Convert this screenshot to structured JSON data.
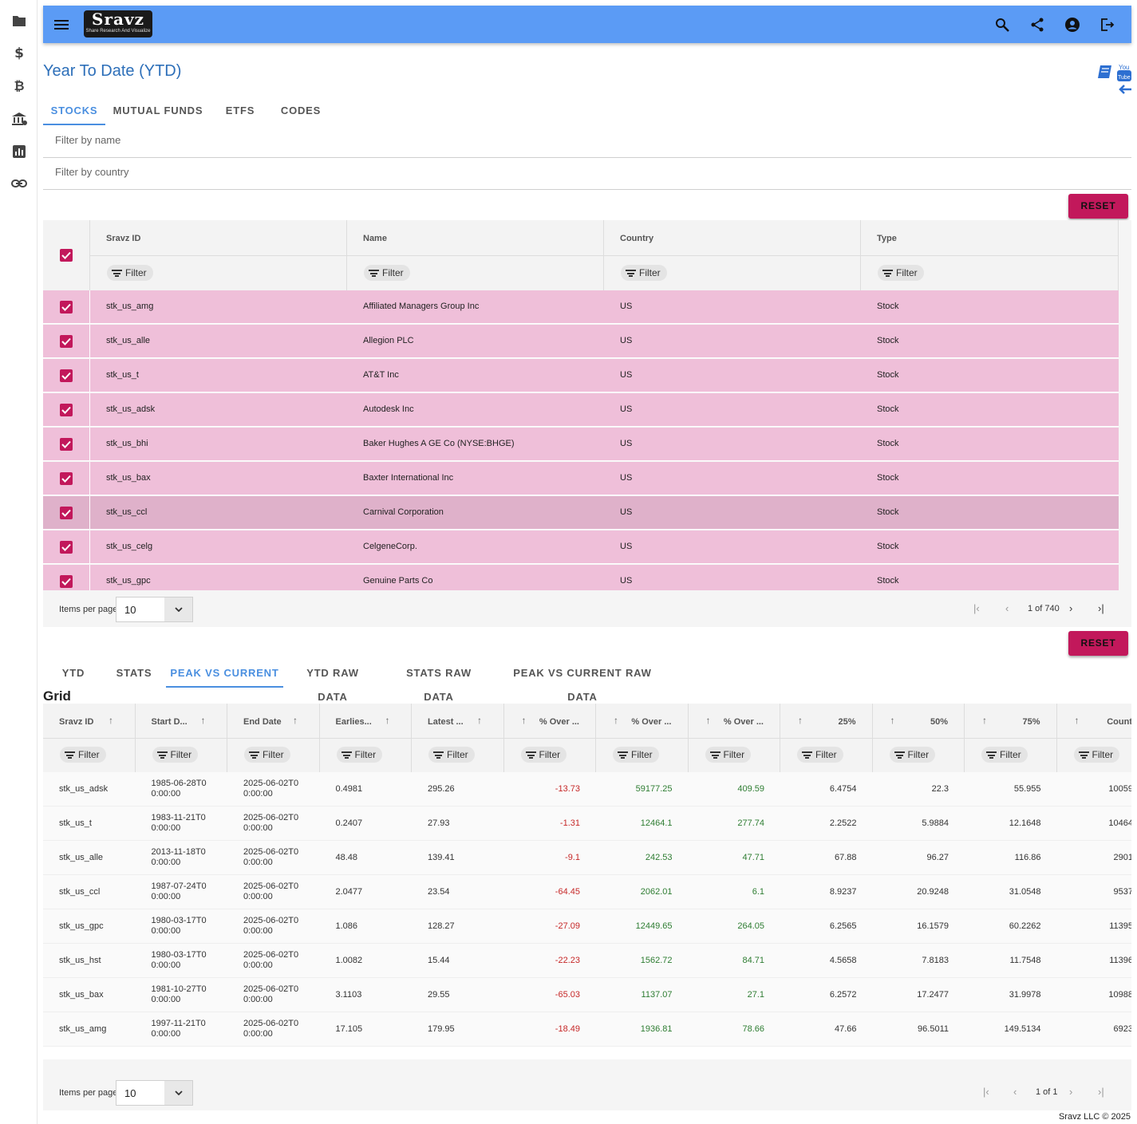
{
  "app": {
    "logo_title": "Sravz",
    "logo_tagline": "Share Research And Visualize",
    "page_title": "Year To Date (YTD)",
    "footer": "Sravz LLC © 2025"
  },
  "rail_icons": [
    "folder-icon",
    "dollar-icon",
    "bitcoin-icon",
    "bank-icon",
    "report-icon",
    "link-icon"
  ],
  "top_tabs": [
    "STOCKS",
    "MUTUAL FUNDS",
    "ETFS",
    "CODES"
  ],
  "filters": {
    "name_placeholder": "Filter by name",
    "country_placeholder": "Filter by country"
  },
  "reset_label": "RESET",
  "grid1": {
    "columns": [
      "Sravz ID",
      "Name",
      "Country",
      "Type"
    ],
    "filter_label": "Filter",
    "rows": [
      {
        "id": "stk_us_amg",
        "name": "Affiliated Managers Group Inc",
        "country": "US",
        "type": "Stock"
      },
      {
        "id": "stk_us_alle",
        "name": "Allegion PLC",
        "country": "US",
        "type": "Stock"
      },
      {
        "id": "stk_us_t",
        "name": "AT&T Inc",
        "country": "US",
        "type": "Stock"
      },
      {
        "id": "stk_us_adsk",
        "name": "Autodesk Inc",
        "country": "US",
        "type": "Stock"
      },
      {
        "id": "stk_us_bhi",
        "name": "Baker Hughes A GE Co (NYSE:BHGE)",
        "country": "US",
        "type": "Stock"
      },
      {
        "id": "stk_us_bax",
        "name": "Baxter International Inc",
        "country": "US",
        "type": "Stock"
      },
      {
        "id": "stk_us_ccl",
        "name": "Carnival Corporation",
        "country": "US",
        "type": "Stock"
      },
      {
        "id": "stk_us_celg",
        "name": "CelgeneCorp.",
        "country": "US",
        "type": "Stock"
      },
      {
        "id": "stk_us_gpc",
        "name": "Genuine Parts Co",
        "country": "US",
        "type": "Stock"
      }
    ],
    "items_per_page_label": "Items per page",
    "items_per_page": "10",
    "page_info": "1 of 740"
  },
  "bottom_tabs": [
    "YTD",
    "STATS",
    "PEAK VS CURRENT",
    "YTD RAW DATA",
    "STATS RAW DATA",
    "PEAK VS CURRENT RAW DATA"
  ],
  "grid_label": "Grid",
  "grid2": {
    "columns": [
      "Sravz ID",
      "Start D...",
      "End Date",
      "Earlies...",
      "Latest ...",
      "% Over ...",
      "% Over ...",
      "% Over ...",
      "25%",
      "50%",
      "75%",
      "Count"
    ],
    "filter_label": "Filter",
    "rows": [
      {
        "id": "stk_us_adsk",
        "start": "1985-06-28T00:00:00",
        "end": "2025-06-02T00:00:00",
        "earliest": "0.4981",
        "latest": "295.26",
        "o1": "-13.73",
        "o2": "59177.25",
        "o3": "409.59",
        "p25": "6.4754",
        "p50": "22.3",
        "p75": "55.955",
        "count": "10059"
      },
      {
        "id": "stk_us_t",
        "start": "1983-11-21T00:00:00",
        "end": "2025-06-02T00:00:00",
        "earliest": "0.2407",
        "latest": "27.93",
        "o1": "-1.31",
        "o2": "12464.1",
        "o3": "277.74",
        "p25": "2.2522",
        "p50": "5.9884",
        "p75": "12.1648",
        "count": "10464"
      },
      {
        "id": "stk_us_alle",
        "start": "2013-11-18T00:00:00",
        "end": "2025-06-02T00:00:00",
        "earliest": "48.48",
        "latest": "139.41",
        "o1": "-9.1",
        "o2": "242.53",
        "o3": "47.71",
        "p25": "67.88",
        "p50": "96.27",
        "p75": "116.86",
        "count": "2901"
      },
      {
        "id": "stk_us_ccl",
        "start": "1987-07-24T00:00:00",
        "end": "2025-06-02T00:00:00",
        "earliest": "2.0477",
        "latest": "23.54",
        "o1": "-64.45",
        "o2": "2062.01",
        "o3": "6.1",
        "p25": "8.9237",
        "p50": "20.9248",
        "p75": "31.0548",
        "count": "9537"
      },
      {
        "id": "stk_us_gpc",
        "start": "1980-03-17T00:00:00",
        "end": "2025-06-02T00:00:00",
        "earliest": "1.086",
        "latest": "128.27",
        "o1": "-27.09",
        "o2": "12449.65",
        "o3": "264.05",
        "p25": "6.2565",
        "p50": "16.1579",
        "p75": "60.2262",
        "count": "11395"
      },
      {
        "id": "stk_us_hst",
        "start": "1980-03-17T00:00:00",
        "end": "2025-06-02T00:00:00",
        "earliest": "1.0082",
        "latest": "15.44",
        "o1": "-22.23",
        "o2": "1562.72",
        "o3": "84.71",
        "p25": "4.5658",
        "p50": "7.8183",
        "p75": "11.7548",
        "count": "11396"
      },
      {
        "id": "stk_us_bax",
        "start": "1981-10-27T00:00:00",
        "end": "2025-06-02T00:00:00",
        "earliest": "3.1103",
        "latest": "29.55",
        "o1": "-65.03",
        "o2": "1137.07",
        "o3": "27.1",
        "p25": "6.2572",
        "p50": "17.2477",
        "p75": "31.9978",
        "count": "10988"
      },
      {
        "id": "stk_us_amg",
        "start": "1997-11-21T00:00:00",
        "end": "2025-06-02T00:00:00",
        "earliest": "17.105",
        "latest": "179.95",
        "o1": "-18.49",
        "o2": "1936.81",
        "o3": "78.66",
        "p25": "47.66",
        "p50": "96.5011",
        "p75": "149.5134",
        "count": "6923"
      }
    ],
    "items_per_page_label": "Items per page",
    "items_per_page": "10",
    "page_info": "1 of 1"
  },
  "colors": {
    "header": "#5b9bf5",
    "accent": "#c2185b",
    "row_selected": "#efbfd9",
    "tab_active": "#4a8fe0",
    "negative": "#c62828",
    "positive": "#2e7d32"
  }
}
